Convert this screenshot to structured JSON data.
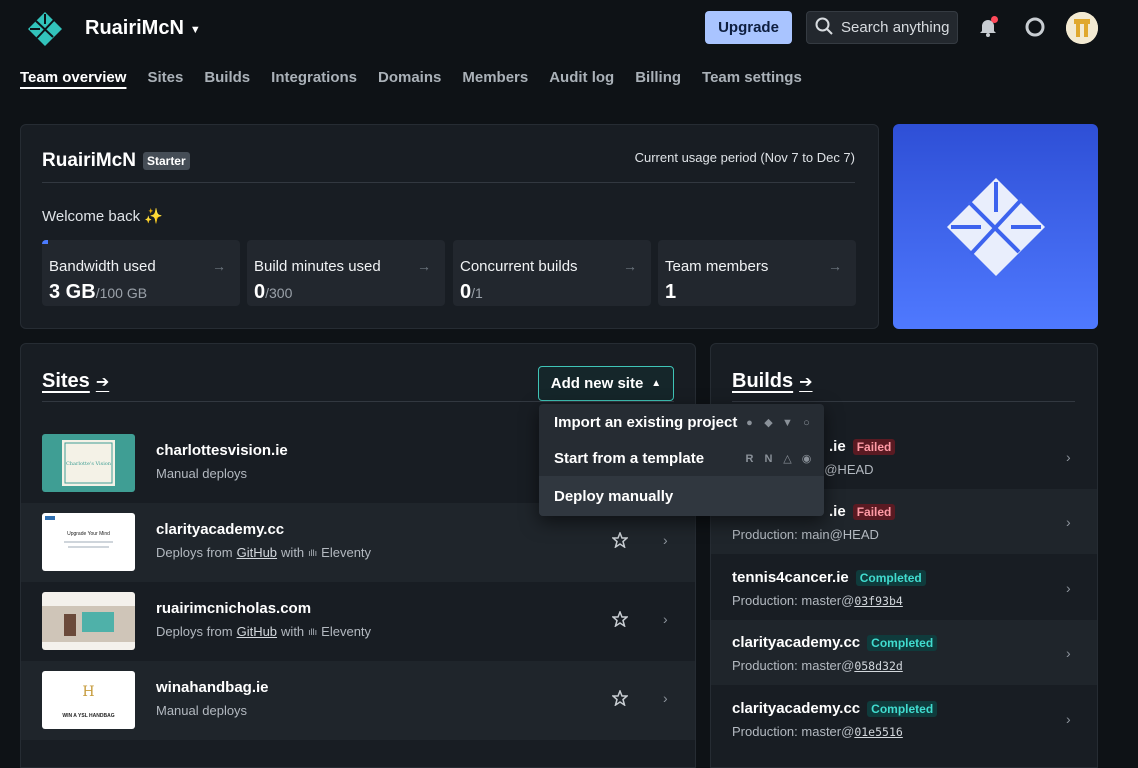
{
  "header": {
    "team_name": "RuairiMcN",
    "upgrade_label": "Upgrade",
    "search_label": "Search anything"
  },
  "nav": {
    "items": [
      "Team overview",
      "Sites",
      "Builds",
      "Integrations",
      "Domains",
      "Members",
      "Audit log",
      "Billing",
      "Team settings"
    ]
  },
  "overview": {
    "name": "RuairiMcN",
    "plan_badge": "Starter",
    "usage_period": "Current usage period (Nov 7 to Dec 7)",
    "welcome": "Welcome back ✨",
    "stats": [
      {
        "label": "Bandwidth used",
        "value": "3 GB",
        "limit": "/100 GB",
        "fill": 0.03
      },
      {
        "label": "Build minutes used",
        "value": "0",
        "limit": "/300",
        "fill": 0
      },
      {
        "label": "Concurrent builds",
        "value": "0",
        "limit": "/1",
        "fill": 0
      },
      {
        "label": "Team members",
        "value": "1",
        "limit": "",
        "fill": 0
      }
    ]
  },
  "sites": {
    "title": "Sites",
    "add_button": "Add new site",
    "dropdown": {
      "import": "Import an existing project",
      "template": "Start from a template",
      "manual": "Deploy manually"
    },
    "rows": [
      {
        "name": "charlottesvision.ie",
        "sub": "Manual deploys"
      },
      {
        "name": "clarityacademy.cc",
        "sub_prefix": "Deploys from",
        "provider": "GitHub",
        "sub_with": "with",
        "framework": "Eleventy"
      },
      {
        "name": "ruairimcnicholas.com",
        "sub_prefix": "Deploys from",
        "provider": "GitHub",
        "sub_with": "with",
        "framework": "Eleventy"
      },
      {
        "name": "winahandbag.ie",
        "sub": "Manual deploys"
      }
    ]
  },
  "builds": {
    "title": "Builds",
    "rows": [
      {
        "name": ".ie",
        "status": "Failed",
        "sub_prefix": "",
        "ref": "n@HEAD"
      },
      {
        "name": ".ie",
        "status": "Failed",
        "sub_prefix": "Production:",
        "ref": "main@HEAD"
      },
      {
        "name": "tennis4cancer.ie",
        "status": "Completed",
        "sub_prefix": "Production:",
        "ref": "master@",
        "hash": "03f93b4"
      },
      {
        "name": "clarityacademy.cc",
        "status": "Completed",
        "sub_prefix": "Production:",
        "ref": "master@",
        "hash": "058d32d"
      },
      {
        "name": "clarityacademy.cc",
        "status": "Completed",
        "sub_prefix": "Production:",
        "ref": "master@",
        "hash": "01e5516"
      }
    ]
  },
  "thumbs": {
    "charlotte_title": "Charlotte's Vision",
    "clarity_title": "Upgrade Your Mind",
    "winahandbag_title": "WIN A YSL HANDBAG"
  },
  "colors": {
    "accent_teal": "#3fc4b7",
    "upgrade_bg": "#a9c4ff",
    "failed": "#ff9aa5",
    "completed": "#41dccf"
  }
}
